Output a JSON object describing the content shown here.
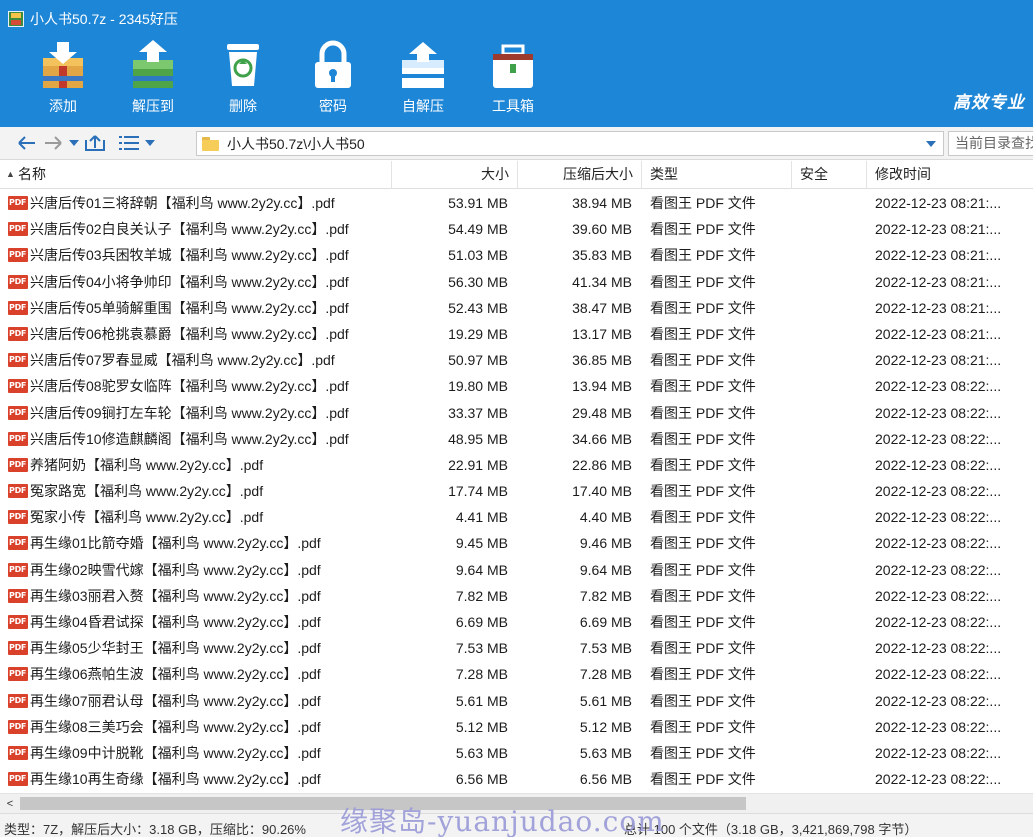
{
  "window": {
    "title": "小人书50.7z - 2345好压"
  },
  "toolbar": {
    "buttons": [
      {
        "label": "添加",
        "icon": "add-icon"
      },
      {
        "label": "解压到",
        "icon": "extract-icon"
      },
      {
        "label": "删除",
        "icon": "delete-icon"
      },
      {
        "label": "密码",
        "icon": "lock-icon"
      },
      {
        "label": "自解压",
        "icon": "sfx-icon"
      },
      {
        "label": "工具箱",
        "icon": "toolbox-icon"
      }
    ],
    "brand": "高效专业"
  },
  "address": {
    "path": "小人书50.7z\\小人书50",
    "search_placeholder": "当前目录查找"
  },
  "columns": {
    "name": "名称",
    "size": "大小",
    "compressed": "压缩后大小",
    "type": "类型",
    "security": "安全",
    "modified": "修改时间"
  },
  "files": [
    {
      "name": "兴唐后传01三将辞朝【福利鸟  www.2y2y.cc】.pdf",
      "size": "53.91 MB",
      "compressed": "38.94 MB",
      "type": "看图王 PDF 文件",
      "security": "",
      "modified": "2022-12-23 08:21:..."
    },
    {
      "name": "兴唐后传02白良关认子【福利鸟  www.2y2y.cc】.pdf",
      "size": "54.49 MB",
      "compressed": "39.60 MB",
      "type": "看图王 PDF 文件",
      "security": "",
      "modified": "2022-12-23 08:21:..."
    },
    {
      "name": "兴唐后传03兵困牧羊城【福利鸟  www.2y2y.cc】.pdf",
      "size": "51.03 MB",
      "compressed": "35.83 MB",
      "type": "看图王 PDF 文件",
      "security": "",
      "modified": "2022-12-23 08:21:..."
    },
    {
      "name": "兴唐后传04小将争帅印【福利鸟  www.2y2y.cc】.pdf",
      "size": "56.30 MB",
      "compressed": "41.34 MB",
      "type": "看图王 PDF 文件",
      "security": "",
      "modified": "2022-12-23 08:21:..."
    },
    {
      "name": "兴唐后传05单骑解重围【福利鸟  www.2y2y.cc】.pdf",
      "size": "52.43 MB",
      "compressed": "38.47 MB",
      "type": "看图王 PDF 文件",
      "security": "",
      "modified": "2022-12-23 08:21:..."
    },
    {
      "name": "兴唐后传06枪挑袁慕爵【福利鸟  www.2y2y.cc】.pdf",
      "size": "19.29 MB",
      "compressed": "13.17 MB",
      "type": "看图王 PDF 文件",
      "security": "",
      "modified": "2022-12-23 08:21:..."
    },
    {
      "name": "兴唐后传07罗春显威【福利鸟  www.2y2y.cc】.pdf",
      "size": "50.97 MB",
      "compressed": "36.85 MB",
      "type": "看图王 PDF 文件",
      "security": "",
      "modified": "2022-12-23 08:21:..."
    },
    {
      "name": "兴唐后传08驼罗女临阵【福利鸟  www.2y2y.cc】.pdf",
      "size": "19.80 MB",
      "compressed": "13.94 MB",
      "type": "看图王 PDF 文件",
      "security": "",
      "modified": "2022-12-23 08:22:..."
    },
    {
      "name": "兴唐后传09锏打左车轮【福利鸟  www.2y2y.cc】.pdf",
      "size": "33.37 MB",
      "compressed": "29.48 MB",
      "type": "看图王 PDF 文件",
      "security": "",
      "modified": "2022-12-23 08:22:..."
    },
    {
      "name": "兴唐后传10修造麒麟阁【福利鸟  www.2y2y.cc】.pdf",
      "size": "48.95 MB",
      "compressed": "34.66 MB",
      "type": "看图王 PDF 文件",
      "security": "",
      "modified": "2022-12-23 08:22:..."
    },
    {
      "name": "养猪阿奶【福利鸟  www.2y2y.cc】.pdf",
      "size": "22.91 MB",
      "compressed": "22.86 MB",
      "type": "看图王 PDF 文件",
      "security": "",
      "modified": "2022-12-23 08:22:..."
    },
    {
      "name": "冤家路宽【福利鸟  www.2y2y.cc】.pdf",
      "size": "17.74 MB",
      "compressed": "17.40 MB",
      "type": "看图王 PDF 文件",
      "security": "",
      "modified": "2022-12-23 08:22:..."
    },
    {
      "name": "冤家小传【福利鸟  www.2y2y.cc】.pdf",
      "size": "4.41 MB",
      "compressed": "4.40 MB",
      "type": "看图王 PDF 文件",
      "security": "",
      "modified": "2022-12-23 08:22:..."
    },
    {
      "name": "再生缘01比箭夺婚【福利鸟  www.2y2y.cc】.pdf",
      "size": "9.45 MB",
      "compressed": "9.46 MB",
      "type": "看图王 PDF 文件",
      "security": "",
      "modified": "2022-12-23 08:22:..."
    },
    {
      "name": "再生缘02映雪代嫁【福利鸟  www.2y2y.cc】.pdf",
      "size": "9.64 MB",
      "compressed": "9.64 MB",
      "type": "看图王 PDF 文件",
      "security": "",
      "modified": "2022-12-23 08:22:..."
    },
    {
      "name": "再生缘03丽君入赘【福利鸟  www.2y2y.cc】.pdf",
      "size": "7.82 MB",
      "compressed": "7.82 MB",
      "type": "看图王 PDF 文件",
      "security": "",
      "modified": "2022-12-23 08:22:..."
    },
    {
      "name": "再生缘04昏君试探【福利鸟  www.2y2y.cc】.pdf",
      "size": "6.69 MB",
      "compressed": "6.69 MB",
      "type": "看图王 PDF 文件",
      "security": "",
      "modified": "2022-12-23 08:22:..."
    },
    {
      "name": "再生缘05少华封王【福利鸟  www.2y2y.cc】.pdf",
      "size": "7.53 MB",
      "compressed": "7.53 MB",
      "type": "看图王 PDF 文件",
      "security": "",
      "modified": "2022-12-23 08:22:..."
    },
    {
      "name": "再生缘06燕帕生波【福利鸟  www.2y2y.cc】.pdf",
      "size": "7.28 MB",
      "compressed": "7.28 MB",
      "type": "看图王 PDF 文件",
      "security": "",
      "modified": "2022-12-23 08:22:..."
    },
    {
      "name": "再生缘07丽君认母【福利鸟  www.2y2y.cc】.pdf",
      "size": "5.61 MB",
      "compressed": "5.61 MB",
      "type": "看图王 PDF 文件",
      "security": "",
      "modified": "2022-12-23 08:22:..."
    },
    {
      "name": "再生缘08三美巧会【福利鸟  www.2y2y.cc】.pdf",
      "size": "5.12 MB",
      "compressed": "5.12 MB",
      "type": "看图王 PDF 文件",
      "security": "",
      "modified": "2022-12-23 08:22:..."
    },
    {
      "name": "再生缘09中计脱靴【福利鸟  www.2y2y.cc】.pdf",
      "size": "5.63 MB",
      "compressed": "5.63 MB",
      "type": "看图王 PDF 文件",
      "security": "",
      "modified": "2022-12-23 08:22:..."
    },
    {
      "name": "再生缘10再生奇缘【福利鸟  www.2y2y.cc】.pdf",
      "size": "6.56 MB",
      "compressed": "6.56 MB",
      "type": "看图王 PDF 文件",
      "security": "",
      "modified": "2022-12-23 08:22:..."
    }
  ],
  "status": {
    "left": "类型：7Z，解压后大小：3.18 GB，压缩比：90.26%",
    "right": "总计 100 个文件（3.18 GB，3,421,869,798 字节）"
  },
  "watermark": "缘聚岛-yuanjudao.com",
  "colors": {
    "ribbon": "#1e86d6",
    "pdf_icon": "#d9412b",
    "folder": "#f7cd5a"
  }
}
